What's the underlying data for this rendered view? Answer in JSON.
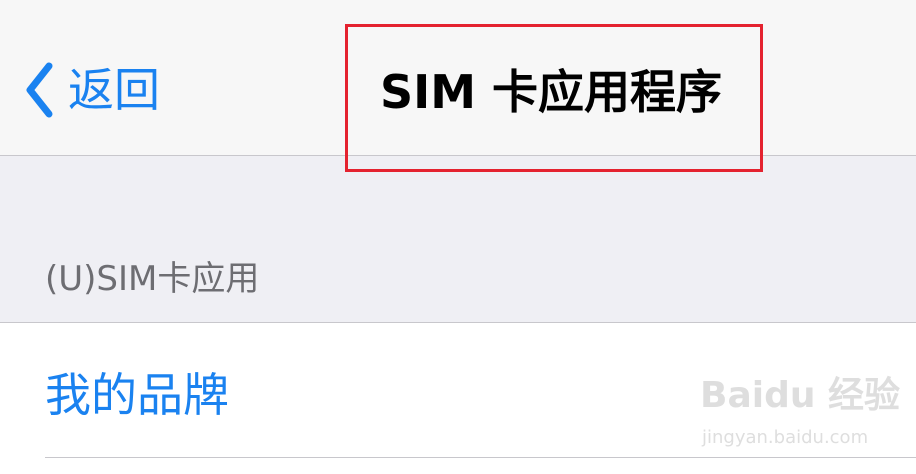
{
  "nav": {
    "back_label": "返回",
    "title": "SIM 卡应用程序"
  },
  "section": {
    "header": "(U)SIM卡应用"
  },
  "list": {
    "items": [
      {
        "label": "我的品牌"
      }
    ]
  },
  "watermark": {
    "logo": "Baidu 经验",
    "url": "jingyan.baidu.com"
  },
  "colors": {
    "accent": "#1a82f0",
    "highlight_box": "#e4222f",
    "background": "#efeff4",
    "nav_background": "#f7f7f7",
    "separator": "#c8c7cc"
  },
  "icons": {
    "back": "chevron-left-icon"
  }
}
